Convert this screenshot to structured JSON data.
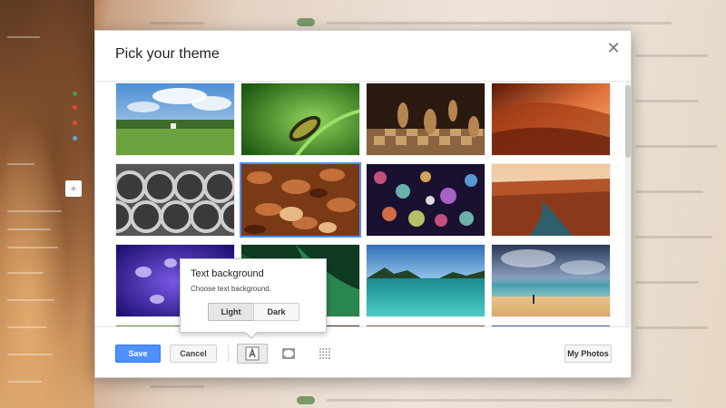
{
  "dialog": {
    "title": "Pick your theme",
    "close_icon": "close-icon"
  },
  "themes": [
    {
      "name": "park-field",
      "selected": false
    },
    {
      "name": "caterpillar",
      "selected": false
    },
    {
      "name": "chess-pieces",
      "selected": false
    },
    {
      "name": "canyon-glow",
      "selected": false
    },
    {
      "name": "steel-pipes",
      "selected": false
    },
    {
      "name": "autumn-leaves",
      "selected": true
    },
    {
      "name": "bokeh-lights",
      "selected": false
    },
    {
      "name": "river-canyon",
      "selected": false
    },
    {
      "name": "jellyfish",
      "selected": false
    },
    {
      "name": "green-abstract",
      "selected": false
    },
    {
      "name": "lake-shore",
      "selected": false
    },
    {
      "name": "beach-sunset",
      "selected": false
    }
  ],
  "footer": {
    "save_label": "Save",
    "cancel_label": "Cancel",
    "my_photos_label": "My Photos",
    "tools": [
      "text-background-icon",
      "vignette-icon",
      "blur-icon"
    ]
  },
  "text_background_popup": {
    "title": "Text background",
    "description": "Choose text background.",
    "options": [
      "Light",
      "Dark"
    ],
    "selected": "Light"
  },
  "colors": {
    "accent": "#4d90fe",
    "dialog_bg": "#ffffff"
  }
}
